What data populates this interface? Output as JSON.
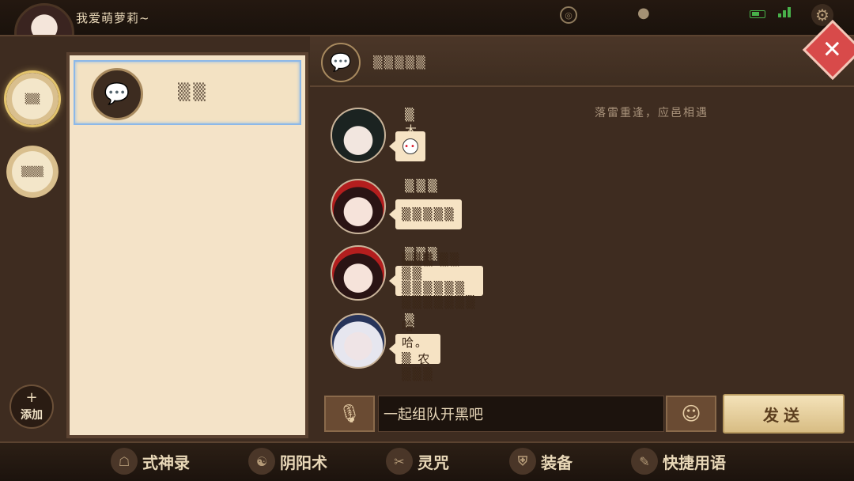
{
  "player": {
    "name": "我爱萌萝莉~"
  },
  "status": {
    "battery_color": "#48b14a",
    "signal_color": "#48b14a"
  },
  "left_rail": {
    "buttons": [
      {
        "label": "▒▒"
      },
      {
        "label": "▒▒▒"
      }
    ],
    "add_label": "添加",
    "add_icon": "+"
  },
  "friend_list": {
    "items": [
      {
        "name": "▒▒"
      }
    ]
  },
  "chat": {
    "title": "▒▒▒▒▒",
    "background_subline": "落雷重逢，应邑相遇",
    "messages": [
      {
        "sender": "▒木  ▒.",
        "text": "",
        "sticker": true
      },
      {
        "sender": "▒▒▒",
        "text": "▒▒▒▒▒"
      },
      {
        "sender": "▒▒▒",
        "text": "▒▒▒  ▒▒  ▒▒  ▒▒▒▒▒▒  ▒▒▒▒▒▒▒"
      },
      {
        "sender": "▒",
        "text": "哈哈。▒  农▒▒▒"
      }
    ]
  },
  "input": {
    "value": "一起组队开黑吧",
    "send_label": "发送"
  },
  "bottom_menu": [
    {
      "label": "式神录",
      "icon": "mask-icon"
    },
    {
      "label": "阴阳术",
      "icon": "yinyang-icon"
    },
    {
      "label": "灵咒",
      "icon": "scroll-icon"
    },
    {
      "label": "装备",
      "icon": "armor-icon"
    },
    {
      "label": "快捷用语",
      "icon": "quick-icon"
    }
  ]
}
